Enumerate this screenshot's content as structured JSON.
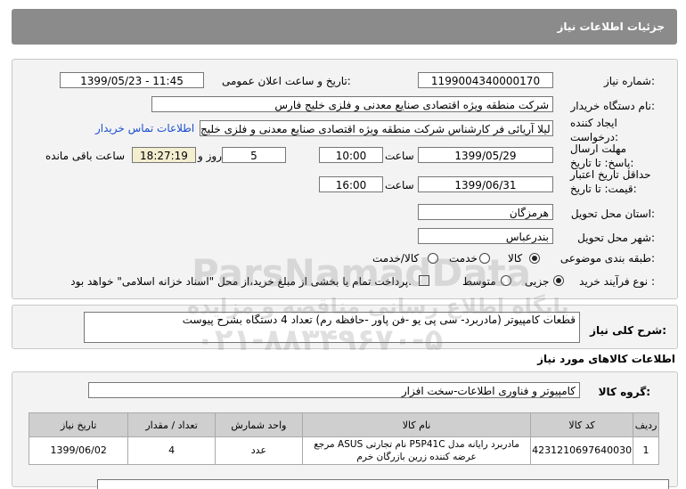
{
  "header": {
    "title": "جزئیات اطلاعات نیاز"
  },
  "fields": {
    "need_number_label": "شماره نیاز:",
    "need_number": "1199004340000170",
    "announce_label": "تاریخ و ساعت اعلان عمومی:",
    "announce_value": "1399/05/23 - 11:45",
    "buyer_label": "نام دستگاه خریدار:",
    "buyer_value": "شرکت منطقه ویژه اقتصادی صنایع معدنی و فلزی خلیج فارس",
    "creator_label": "ایجاد کننده درخواست:",
    "creator_value": "لیلا آریائی فر کارشناس شرکت منطقه ویژه اقتصادی صنایع معدنی و فلزی خلیج",
    "contact_link": "اطلاعات تماس خریدار",
    "deadline_label": "مهلت ارسال پاسخ: تا تاریخ:",
    "deadline_date": "1399/05/29",
    "time_label": "ساعت",
    "deadline_time": "10:00",
    "days_value": "5",
    "days_label": "روز و",
    "remaining_time": "18:27:19",
    "remaining_label": "ساعت باقی مانده",
    "validity_label": "حداقل تاریخ اعتبار قیمت: تا تاریخ:",
    "validity_date": "1399/06/31",
    "validity_time_label": "ساعت",
    "validity_time": "16:00",
    "province_label": "استان محل تحویل:",
    "province_value": "هرمزگان",
    "city_label": "شهر محل تحویل:",
    "city_value": "بندرعباس",
    "category_label": "طبقه بندی موضوعی:",
    "category_options": [
      "کالا",
      "خدمت",
      "کالا/خدمت"
    ],
    "purchase_label": "نوع فرآیند خرید :",
    "purchase_options": [
      "جزیی",
      "متوسط"
    ],
    "purchase_note": "پرداخت تمام یا بخشی از مبلغ خرید،از محل \"اسناد خزانه اسلامی\" خواهد بود."
  },
  "description": {
    "label": "شرح کلی نیاز:",
    "value": "قطعات کامپیوتر (مادربرد- سی پی یو -فن پاور -حافظه رم) تعداد 4 دستگاه بشرح پیوست"
  },
  "goods": {
    "section_title": "اطلاعات کالاهای مورد نیاز",
    "group_label": "گروه کالا:",
    "group_value": "کامپیوتر و فناوری اطلاعات-سخت افزار",
    "columns": [
      "ردیف",
      "کد کالا",
      "نام کالا",
      "واحد شمارش",
      "تعداد / مقدار",
      "تاریخ نیاز"
    ],
    "rows": [
      {
        "index": "1",
        "code": "4231210697640030",
        "name": "مادربرد رایانه مدل P5P41C نام تجارتی ASUS مرجع عرضه کننده زرین بازرگان خرم",
        "unit": "عدد",
        "qty": "4",
        "date": "1399/06/02"
      }
    ]
  },
  "watermark": {
    "brand": "ParsNamadData",
    "line1": "پایگاه اطلاع رسانی مناقصه و مزایده",
    "phone": "۰۲۱-۸۸۳۴۹۶۷۰-۵"
  },
  "colors": {
    "title_bg": "#8b8b8b",
    "link": "#1a4fcf",
    "remaining_bg": "#f4eed0"
  }
}
